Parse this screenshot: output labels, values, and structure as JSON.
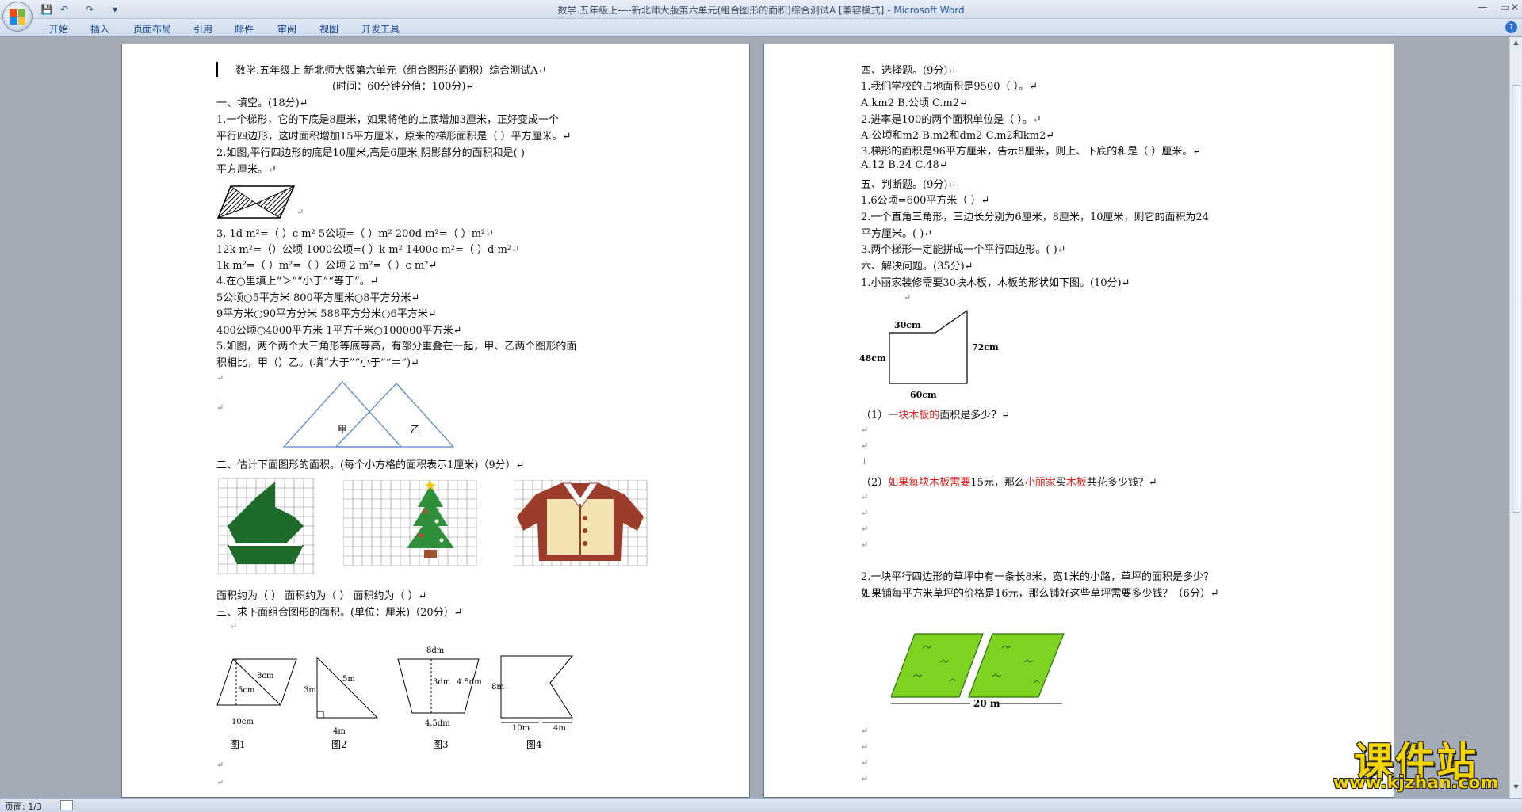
{
  "window": {
    "title": "数学.五年级上----新北师大版第六单元(组合图形的面积)综合测试A [兼容模式]",
    "app_name": " - Microsoft Word",
    "min": "—",
    "max": "▭",
    "close": "✕"
  },
  "quick_access": {
    "save": "💾",
    "undo": "↶",
    "redo": "↷",
    "customize": "▾"
  },
  "ribbon": {
    "tabs": [
      "开始",
      "插入",
      "页面布局",
      "引用",
      "邮件",
      "审阅",
      "视图",
      "开发工具"
    ],
    "help": "?"
  },
  "status": {
    "page": "页面: 1/3"
  },
  "watermark": {
    "title": "课件站",
    "url": "www.kjzhan.com"
  },
  "colors": {
    "accent": "#2a5aa8",
    "red_text": "#e0201c",
    "grass": "#7ed321",
    "tree": "#1e6b2b"
  },
  "page1": {
    "lines": [
      "数学.五年级上      新北师大版第六单元（组合图形的面积）综合测试A↵",
      "(时间：60分钟分值：100分)↵",
      "一、填空。(18分)↵",
      " 1.一个梯形，它的下底是8厘米，如果将他的上底增加3厘米，正好变成一个",
      "平行四边形，这时面积增加15平方厘米，原来的梯形面积是（      ）平方厘米。↵",
      "2.如图,平行四边形的底是10厘米,高是6厘米,阴影部分的面积和是(          )",
      "平方厘米。↵",
      "3.     1d m²=（    ）c m²        5公顷=（        ）m²          200d m²=（    ）m²↵",
      "       12k m²=（）公顷       1000公顷=(          ）k m²    1400c m²=（      ）d m²↵",
      "        1k m²=（      ）m²=（          ）公顷                  2 m²=（        ）c m²↵",
      "4.在○里填上“＞”“小于”“等于”。↵",
      "  5公顷○5平方米                   800平方厘米○8平方分米↵",
      "  9平方米○90平方分米             588平方分米○6平方米↵",
      "  400公顷○4000平方米             1平方千米○100000平方米↵",
      "5.如图，两个两个大三角形等底等高，有部分重叠在一起，甲、乙两个图形的面",
      "积相比，甲（）乙。(填“大于”“小于”“＝”)↵",
      "二、估计下面图形的面积。(每个小方格的面积表示1厘米)（9分）↵",
      "面积约为（        ）       面积约为（          ）            面积约为（          ）↵",
      "三、求下面组合图形的面积。(单位：厘米)（20分）↵"
    ],
    "fig_labels": {
      "jia": "甲",
      "yi": "乙",
      "f1": "图1",
      "f2": "图2",
      "f3": "图3",
      "f4": "图4",
      "f1_8cm": "8cm",
      "f1_5cm": "5cm",
      "f1_10cm": "10cm",
      "f2_3m": "3m",
      "f2_5m": "5m",
      "f2_4m": "4m",
      "f3_8dm": "8dm",
      "f3_3dm": "3dm",
      "f3_45dm_side": "4.5dm",
      "f3_45dm_bottom": "4.5dm",
      "f4_8m": "8m",
      "f4_10m": "10m",
      "f4_4m": "4m"
    }
  },
  "page2": {
    "lines": [
      "四、选择题。(9分)↵",
      "1.我们学校的占地面积是9500（      ）。↵",
      "  A.km2          B.公顷           C.m2↵",
      "2.进率是100的两个面积单位是（            ）。↵",
      " A.公顷和m2          B.m2和dm2          C.m2和km2↵",
      "3.梯形的面积是96平方厘米，告示8厘米，则上、下底的和是（      ）厘米。↵",
      "  A.12              B.24              C.48↵",
      "五、判断题。(9分)↵",
      " 1.6公顷=600平方米（          ）↵",
      " 2.一个直角三角形，三边长分别为6厘米，8厘米，10厘米，则它的面积为24",
      "平方厘米。(              )↵",
      " 3.两个梯形一定能拼成一个平行四边形。(          )↵",
      "六、解决问题。(35分)↵",
      " 1.小丽家装修需要30块木板，木板的形状如下图。(10分)↵",
      "2.一块平行四边形的草坪中有一条长8米，宽1米的小路，草坪的面积是多少？",
      "如果铺每平方米草坪的价格是16元，那么铺好这些草坪需要多少钱？（6分）↵"
    ],
    "q1a": {
      "pre": "（1）一",
      "red": "块木板的",
      "post": "面积是多少？↵"
    },
    "q1b": {
      "pre": "（2）",
      "red1": "如果每",
      "red2": "块木板需要",
      "mid": "15元，那么",
      "red3": "小丽家",
      "mid2": "买",
      "red4": "木板",
      "post": "共花多少钱？↵"
    },
    "board_labels": {
      "top": "30cm",
      "left": "48cm",
      "right": "72cm",
      "bottom": "60cm"
    },
    "lawn_label": "20 m"
  }
}
